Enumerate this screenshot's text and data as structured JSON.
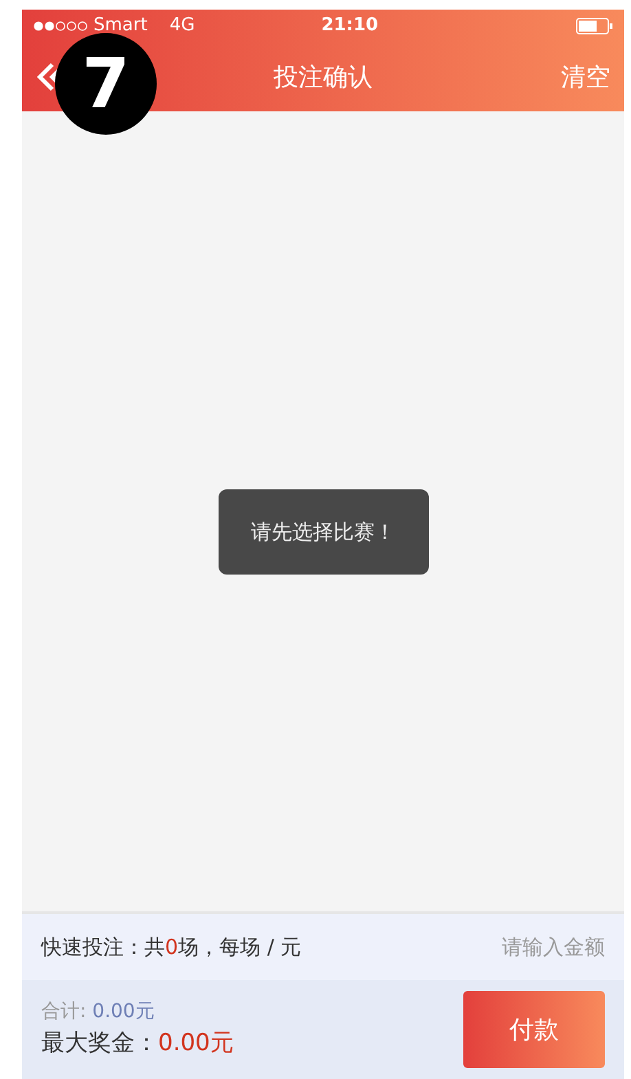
{
  "status_bar": {
    "carrier": "Smart",
    "network": "4G",
    "time": "21:10"
  },
  "nav_bar": {
    "title": "投注确认",
    "action": "清空"
  },
  "step_badge": "7",
  "toast": "请先选择比赛！",
  "quick_bet": {
    "prefix": "快速投注：共",
    "count": "0",
    "suffix": "场，每场 / 元",
    "amount_placeholder": "请输入金额"
  },
  "summary": {
    "total_label": "合计:",
    "total_value": "0.00元",
    "max_prize_label": "最大奖金：",
    "max_prize_value": "0.00元"
  },
  "pay_button": "付款"
}
